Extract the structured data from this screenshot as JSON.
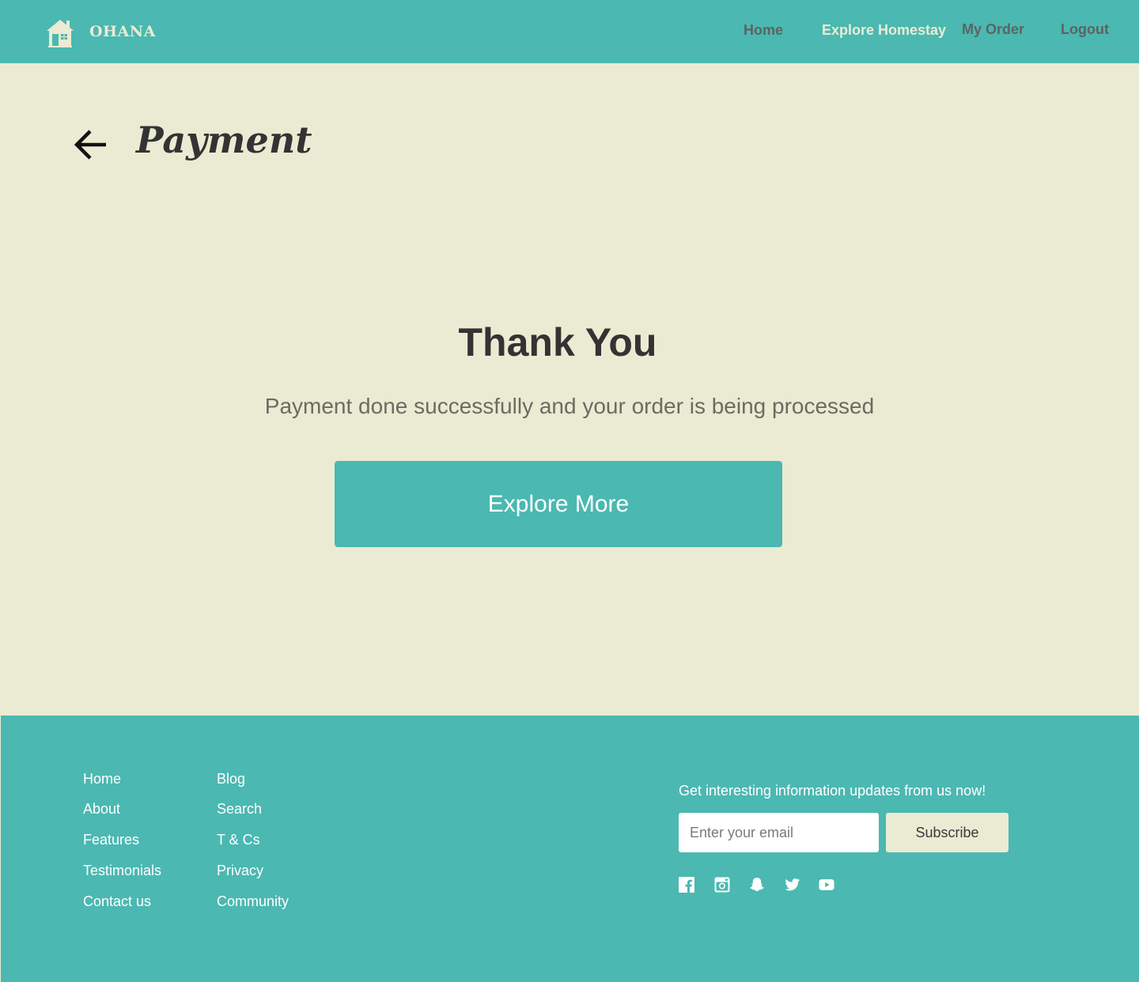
{
  "colors": {
    "accent": "#4bb8b2",
    "background": "#ebebd3",
    "text_dark": "#333333",
    "text_muted": "#6b6b62",
    "nav_inactive": "#5c6462",
    "white": "#ffffff"
  },
  "header": {
    "brand": "OHANA",
    "logo_icon": "house-icon",
    "nav": {
      "home": "Home",
      "explore": "Explore Homestay",
      "order": "My Order",
      "logout": "Logout"
    },
    "active_nav": "explore"
  },
  "page": {
    "back_icon": "arrow-left-icon",
    "title": "Payment"
  },
  "confirmation": {
    "title": "Thank You",
    "message": "Payment done successfully and your order is being processed",
    "cta_label": "Explore More"
  },
  "footer": {
    "links_col1": [
      "Home",
      "About",
      "Features",
      "Testimonials",
      "Contact us"
    ],
    "links_col2": [
      "Blog",
      "Search",
      "T & Cs",
      "Privacy",
      "Community"
    ],
    "newsletter": {
      "text": "Get interesting information updates from us now!",
      "email_placeholder": "Enter your email",
      "email_value": "",
      "subscribe_label": "Subscribe"
    },
    "social_icons": [
      "facebook-icon",
      "instagram-icon",
      "snapchat-icon",
      "twitter-icon",
      "youtube-icon"
    ]
  }
}
